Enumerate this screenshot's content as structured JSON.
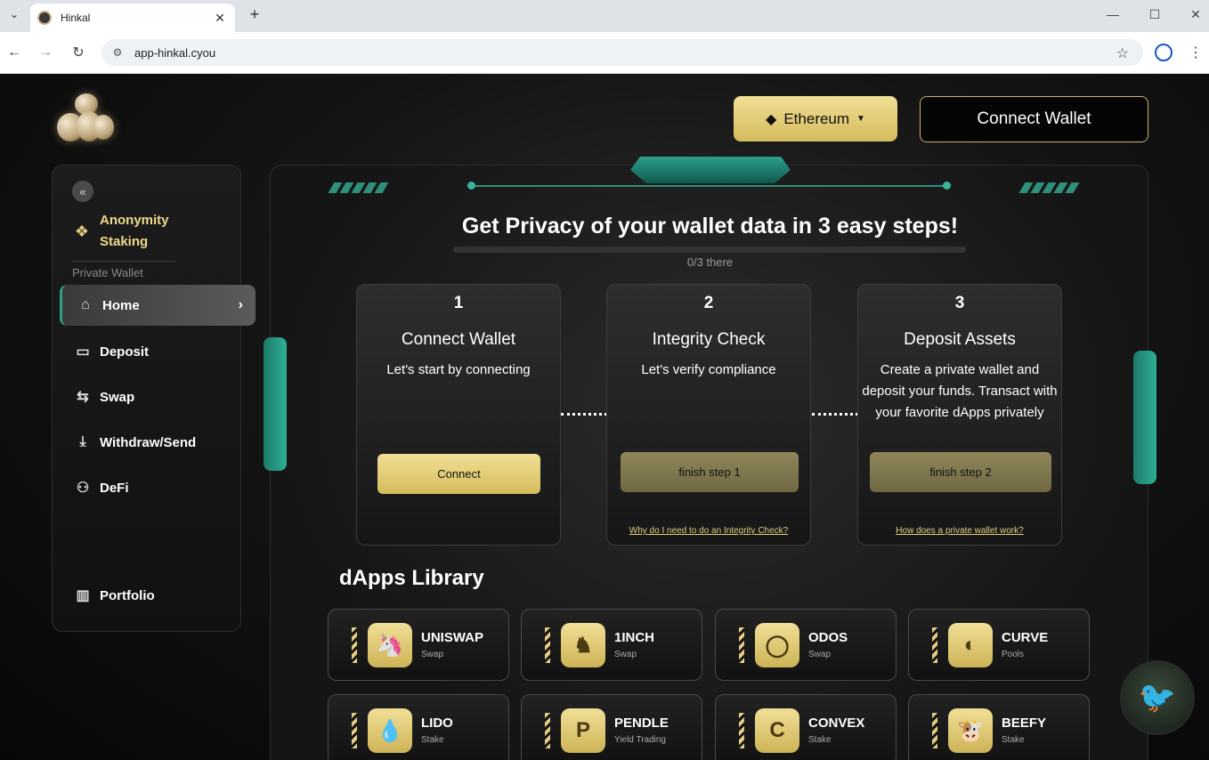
{
  "browser": {
    "tab_title": "Hinkal",
    "url": "app-hinkal.cyou"
  },
  "header": {
    "network": "Ethereum",
    "connect_wallet": "Connect Wallet"
  },
  "sidebar": {
    "anonymity_staking": "Anonymity Staking",
    "section_label": "Private Wallet",
    "items": [
      {
        "label": "Home",
        "icon": "home-icon"
      },
      {
        "label": "Deposit",
        "icon": "wallet-icon"
      },
      {
        "label": "Swap",
        "icon": "swap-icon"
      },
      {
        "label": "Withdraw/Send",
        "icon": "withdraw-icon"
      },
      {
        "label": "DeFi",
        "icon": "defi-icon"
      }
    ],
    "portfolio": "Portfolio"
  },
  "main": {
    "title": "Get Privacy of your wallet data in 3 easy steps!",
    "progress_text": "0/3 there",
    "progress_value": 0,
    "steps": [
      {
        "number": "1",
        "title": "Connect Wallet",
        "desc": "Let's start by connecting",
        "button": "Connect",
        "link": ""
      },
      {
        "number": "2",
        "title": "Integrity Check",
        "desc": "Let's verify compliance",
        "button": "finish step 1",
        "link": "Why do I need to do an Integrity Check?"
      },
      {
        "number": "3",
        "title": "Deposit Assets",
        "desc": "Create a private wallet and deposit your funds. Transact with your favorite dApps privately",
        "button": "finish step 2",
        "link": "How does a private wallet work?"
      }
    ],
    "dapps_title": "dApps Library",
    "dapps": [
      {
        "name": "UNISWAP",
        "sub": "Swap"
      },
      {
        "name": "1INCH",
        "sub": "Swap"
      },
      {
        "name": "ODOS",
        "sub": "Swap"
      },
      {
        "name": "CURVE",
        "sub": "Pools"
      },
      {
        "name": "LIDO",
        "sub": "Stake"
      },
      {
        "name": "PENDLE",
        "sub": "Yield Trading"
      },
      {
        "name": "CONVEX",
        "sub": "Stake"
      },
      {
        "name": "BEEFY",
        "sub": "Stake"
      }
    ]
  },
  "colors": {
    "accent_gold": "#e4cc80",
    "accent_teal": "#2e9f8a"
  }
}
